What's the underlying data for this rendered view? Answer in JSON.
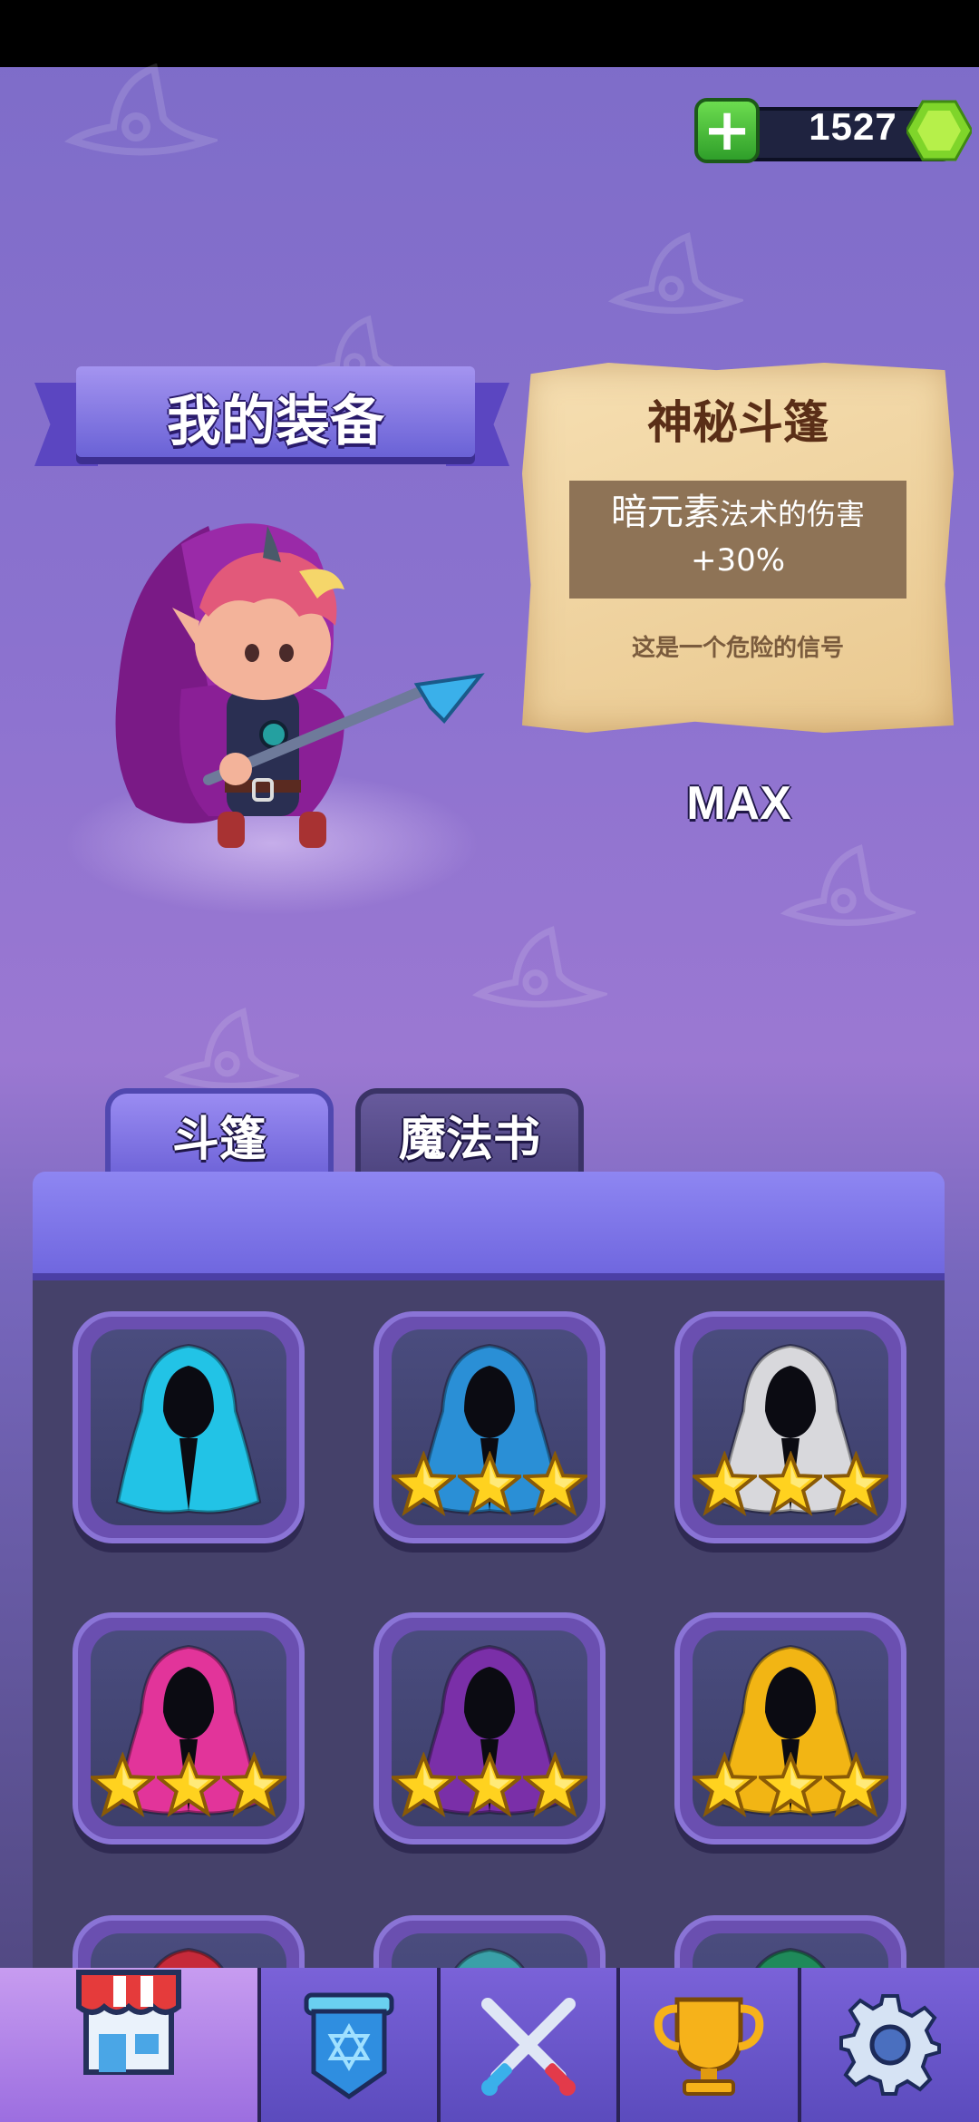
{
  "gems": {
    "count": "1527"
  },
  "banner": {
    "title": "我的装备"
  },
  "item_info": {
    "name": "神秘斗篷",
    "effect_element": "暗元素",
    "effect_text": "法术的伤害",
    "effect_value": "+30%",
    "description": "这是一个危险的信号",
    "level": "MAX"
  },
  "tabs": [
    {
      "label": "斗篷",
      "selected": true
    },
    {
      "label": "魔法书",
      "selected": false
    }
  ],
  "cloaks": [
    {
      "name": "cyan-cloak",
      "color": "#22c3e6",
      "stars": 0
    },
    {
      "name": "blue-star-cloak",
      "color": "#2a8fd6",
      "stars": 3
    },
    {
      "name": "plaid-cloak",
      "color": "#d8d8dc",
      "stars": 3
    },
    {
      "name": "pink-heart-cloak",
      "color": "#e2349a",
      "stars": 3
    },
    {
      "name": "purple-star-cloak",
      "color": "#7a2fa8",
      "stars": 3
    },
    {
      "name": "gold-swirl-cloak",
      "color": "#f2b514",
      "stars": 3
    },
    {
      "name": "red-cloak",
      "color": "#c62a3a",
      "stars": 0
    },
    {
      "name": "teal-cloak",
      "color": "#3aa0a8",
      "stars": 0
    },
    {
      "name": "green-cloak",
      "color": "#1f8a5a",
      "stars": 0
    }
  ],
  "nav": [
    {
      "name": "shop-icon",
      "selected": true
    },
    {
      "name": "equipment-icon",
      "selected": false
    },
    {
      "name": "battle-icon",
      "selected": false
    },
    {
      "name": "trophy-icon",
      "selected": false
    },
    {
      "name": "settings-icon",
      "selected": false
    }
  ]
}
